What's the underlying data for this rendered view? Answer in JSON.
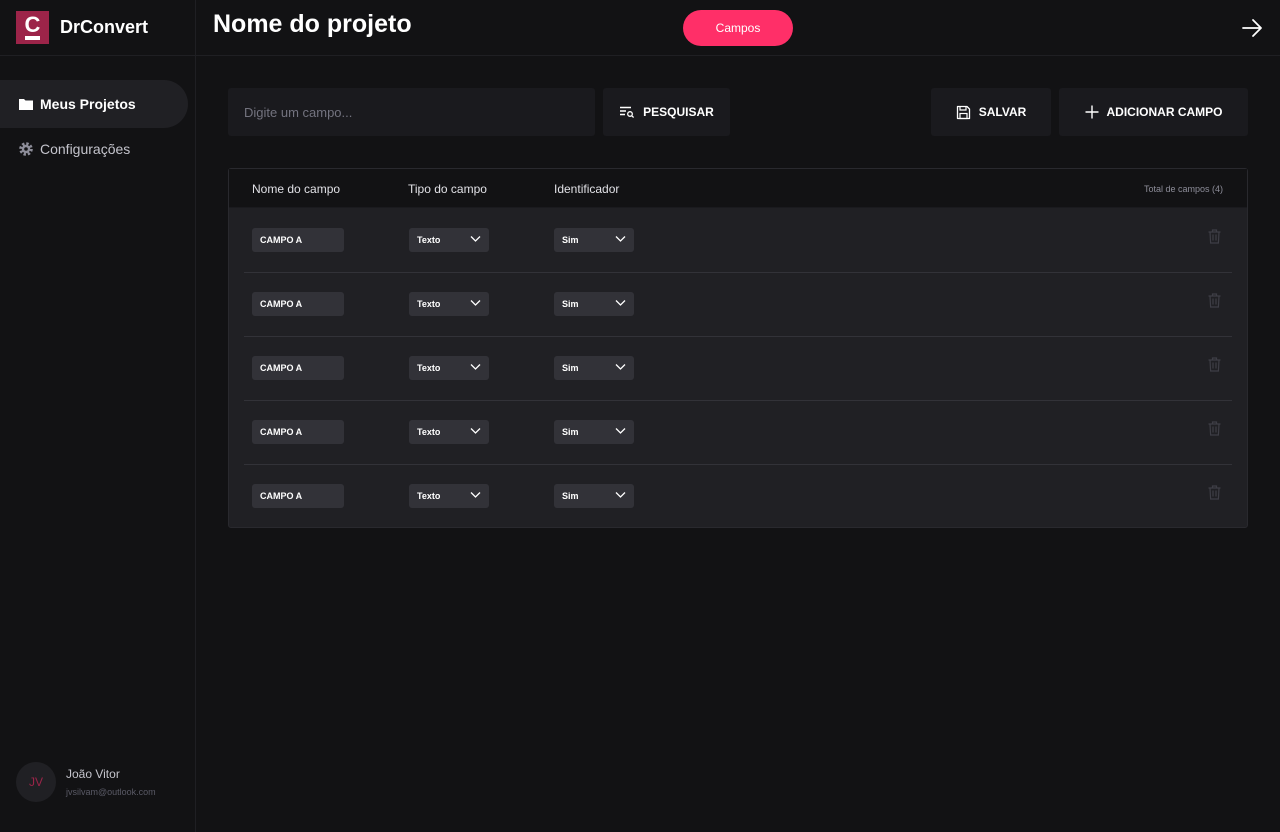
{
  "app": {
    "name": "DrConvert",
    "logo_letter": "C",
    "accent": "#9c2449",
    "pill_color": "#ff2f68"
  },
  "sidebar": {
    "items": [
      {
        "label": "Meus Projetos",
        "icon": "folder-icon",
        "active": true
      },
      {
        "label": "Configurações",
        "icon": "gear-icon",
        "active": false
      }
    ],
    "user": {
      "initials": "JV",
      "name": "João Vitor",
      "email": "jvsilvam@outlook.com"
    }
  },
  "header": {
    "title": "Nome do projeto",
    "pill_label": "Campos",
    "exit_icon": "arrow-right-icon"
  },
  "toolbar": {
    "search_placeholder": "Digite um campo...",
    "search_label": "PESQUISAR",
    "save_label": "SALVAR",
    "add_label": "ADICIONAR CAMPO"
  },
  "table": {
    "columns": [
      "Nome do campo",
      "Tipo do campo",
      "Identificador"
    ],
    "total_label": "Total de campos (4)",
    "rows": [
      {
        "name": "CAMPO A",
        "type": "Texto",
        "identifier": "Sim"
      },
      {
        "name": "CAMPO A",
        "type": "Texto",
        "identifier": "Sim"
      },
      {
        "name": "CAMPO A",
        "type": "Texto",
        "identifier": "Sim"
      },
      {
        "name": "CAMPO A",
        "type": "Texto",
        "identifier": "Sim"
      },
      {
        "name": "CAMPO A",
        "type": "Texto",
        "identifier": "Sim"
      }
    ]
  }
}
